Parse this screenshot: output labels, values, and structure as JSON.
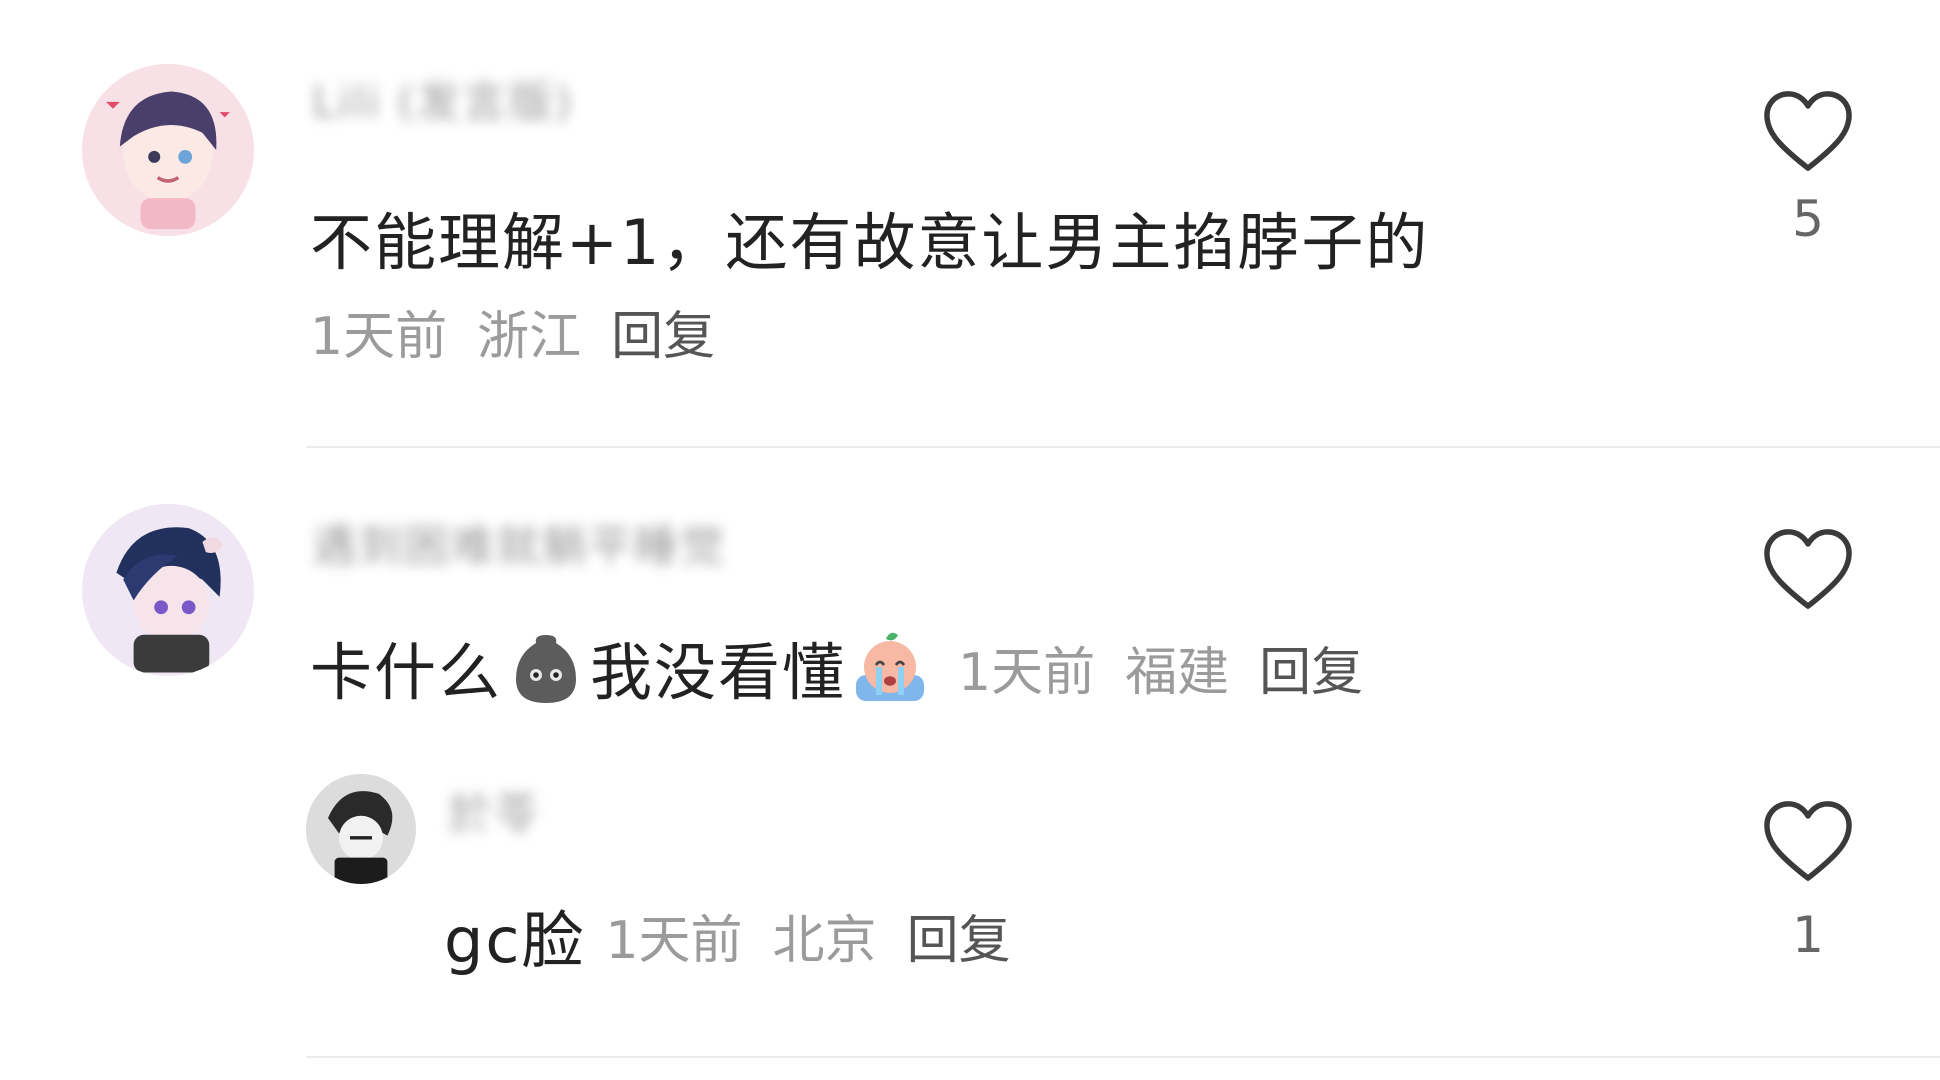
{
  "comments": [
    {
      "username": "Lili (发言版)",
      "text": "不能理解+1，还有故意让男主掐脖子的",
      "time": "1天前",
      "location": "浙江",
      "reply_label": "回复",
      "likes": "5"
    },
    {
      "username": "遇到困难就躺平睡觉",
      "text_a": "卡什么",
      "emoji_a": "sack-emoji",
      "text_b": "我没看懂",
      "emoji_b": "crying-emoji",
      "time": "1天前",
      "location": "福建",
      "reply_label": "回复",
      "likes": "",
      "reply": {
        "username": "於苓",
        "text": "gc脸",
        "time": "1天前",
        "location": "北京",
        "reply_label": "回复",
        "likes": "1"
      }
    }
  ],
  "icons": {
    "like": "heart-outline-icon"
  },
  "colors": {
    "meta": "#9b9b9b",
    "text": "#222222",
    "divider": "#ececec"
  }
}
